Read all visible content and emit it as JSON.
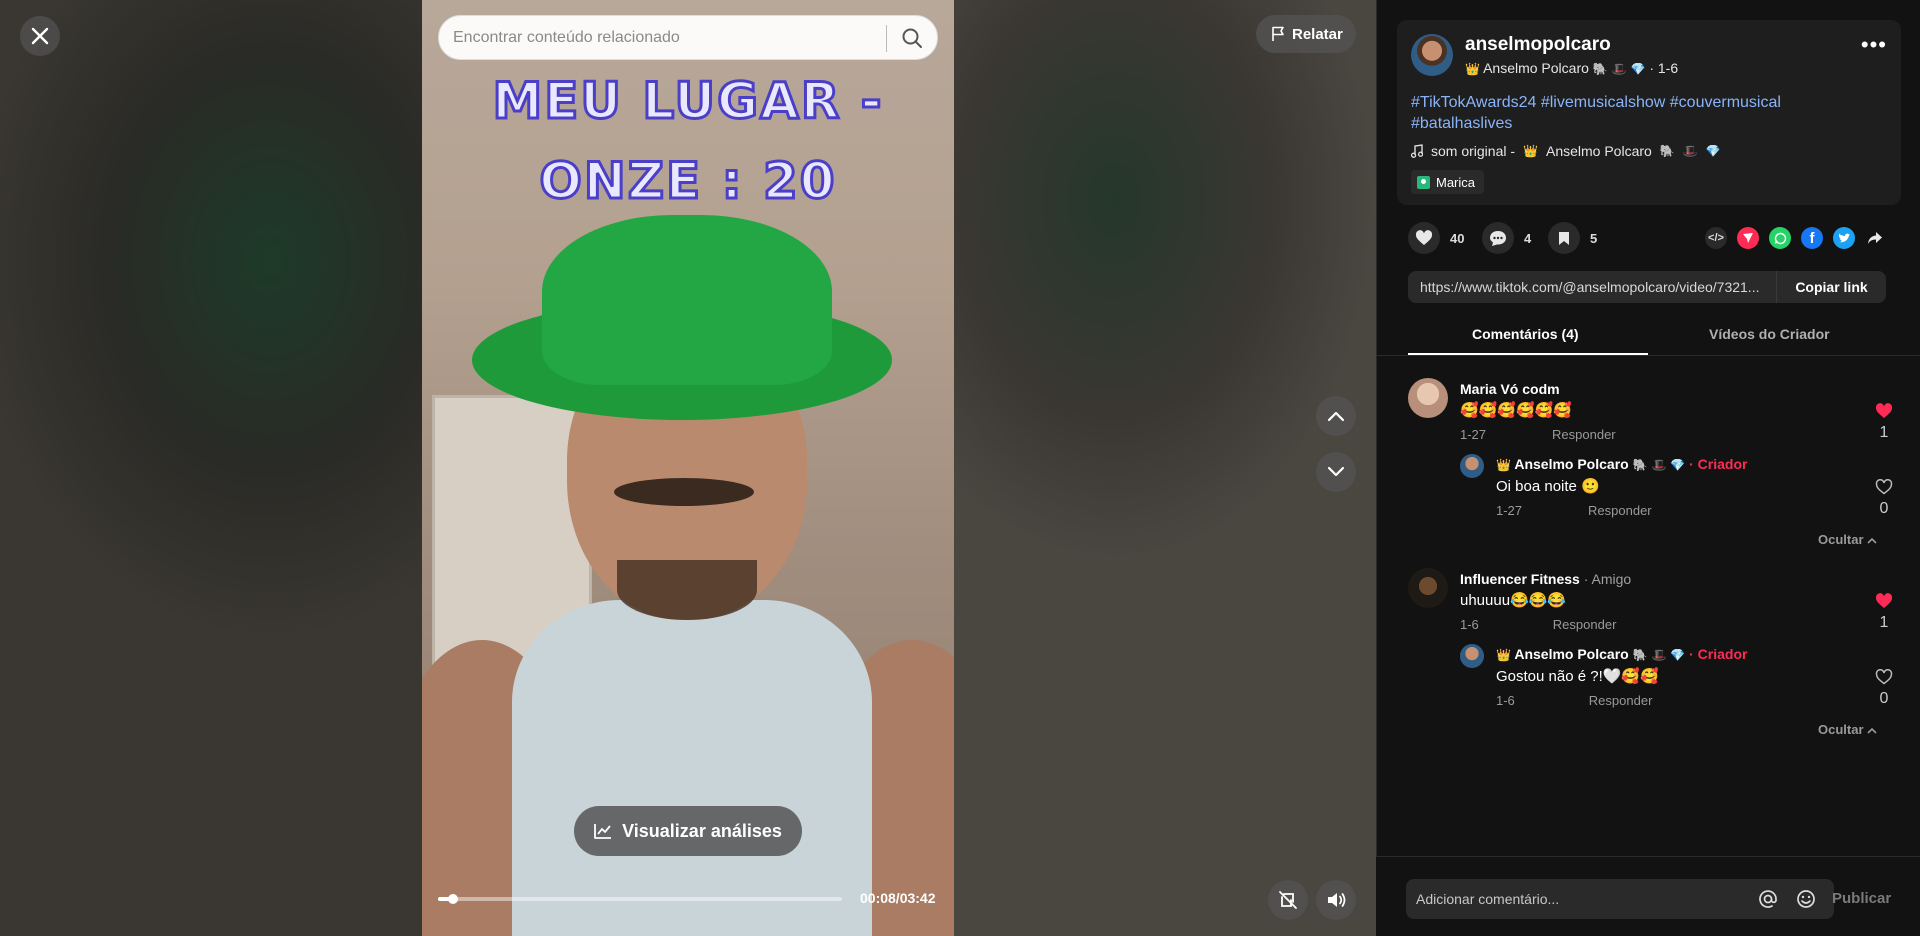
{
  "search": {
    "placeholder": "Encontrar conteúdo relacionado"
  },
  "video": {
    "overlay_line1": "MEU LUGAR  -",
    "overlay_line2": "ONZE : 20",
    "analytics_label": "Visualizar análises",
    "time": "00:08/03:42",
    "progress": 0.036
  },
  "report": {
    "label": "Relatar"
  },
  "author": {
    "username": "anselmopolcaro",
    "nickname": "Anselmo Polcaro",
    "date": "· 1-6"
  },
  "caption": "#TikTokAwards24 #livemusicalshow #couvermusical #batalhaslives",
  "music": {
    "label": "som original -",
    "artist": "Anselmo Polcaro"
  },
  "location": "Marica",
  "stats": {
    "likes": "40",
    "comments": "4",
    "saves": "5"
  },
  "link": {
    "url": "https://www.tiktok.com/@anselmopolcaro/video/7321...",
    "copy_label": "Copiar link"
  },
  "tabs": {
    "comments": "Comentários (4)",
    "videos": "Vídeos do Criador"
  },
  "comments": [
    {
      "name": "Maria Vó codm",
      "text": "🥰🥰🥰🥰🥰🥰",
      "date": "1-27",
      "reply_label": "Responder",
      "likes": "1",
      "reply": {
        "name": "Anselmo Polcaro",
        "creator_label": "· Criador",
        "text": "Oi boa noite 🙂",
        "date": "1-27",
        "reply_label": "Responder",
        "likes": "0"
      },
      "hide_label": "Ocultar"
    },
    {
      "name": "Influencer Fitness",
      "tag": " · Amigo",
      "text": "uhuuuu😂😂😂",
      "date": "1-6",
      "reply_label": "Responder",
      "likes": "1",
      "reply": {
        "name": "Anselmo Polcaro",
        "creator_label": "· Criador",
        "text": "Gostou não é ?!🤍🥰🥰",
        "date": "1-6",
        "reply_label": "Responder",
        "likes": "0"
      },
      "hide_label": "Ocultar"
    }
  ],
  "comment_input": {
    "placeholder": "Adicionar comentário...",
    "post_label": "Publicar"
  },
  "colors": {
    "accent": "#fe2c55",
    "hashtag": "#8ab4f8",
    "panel_bg": "#121212",
    "card_bg": "#1e1e1e"
  }
}
